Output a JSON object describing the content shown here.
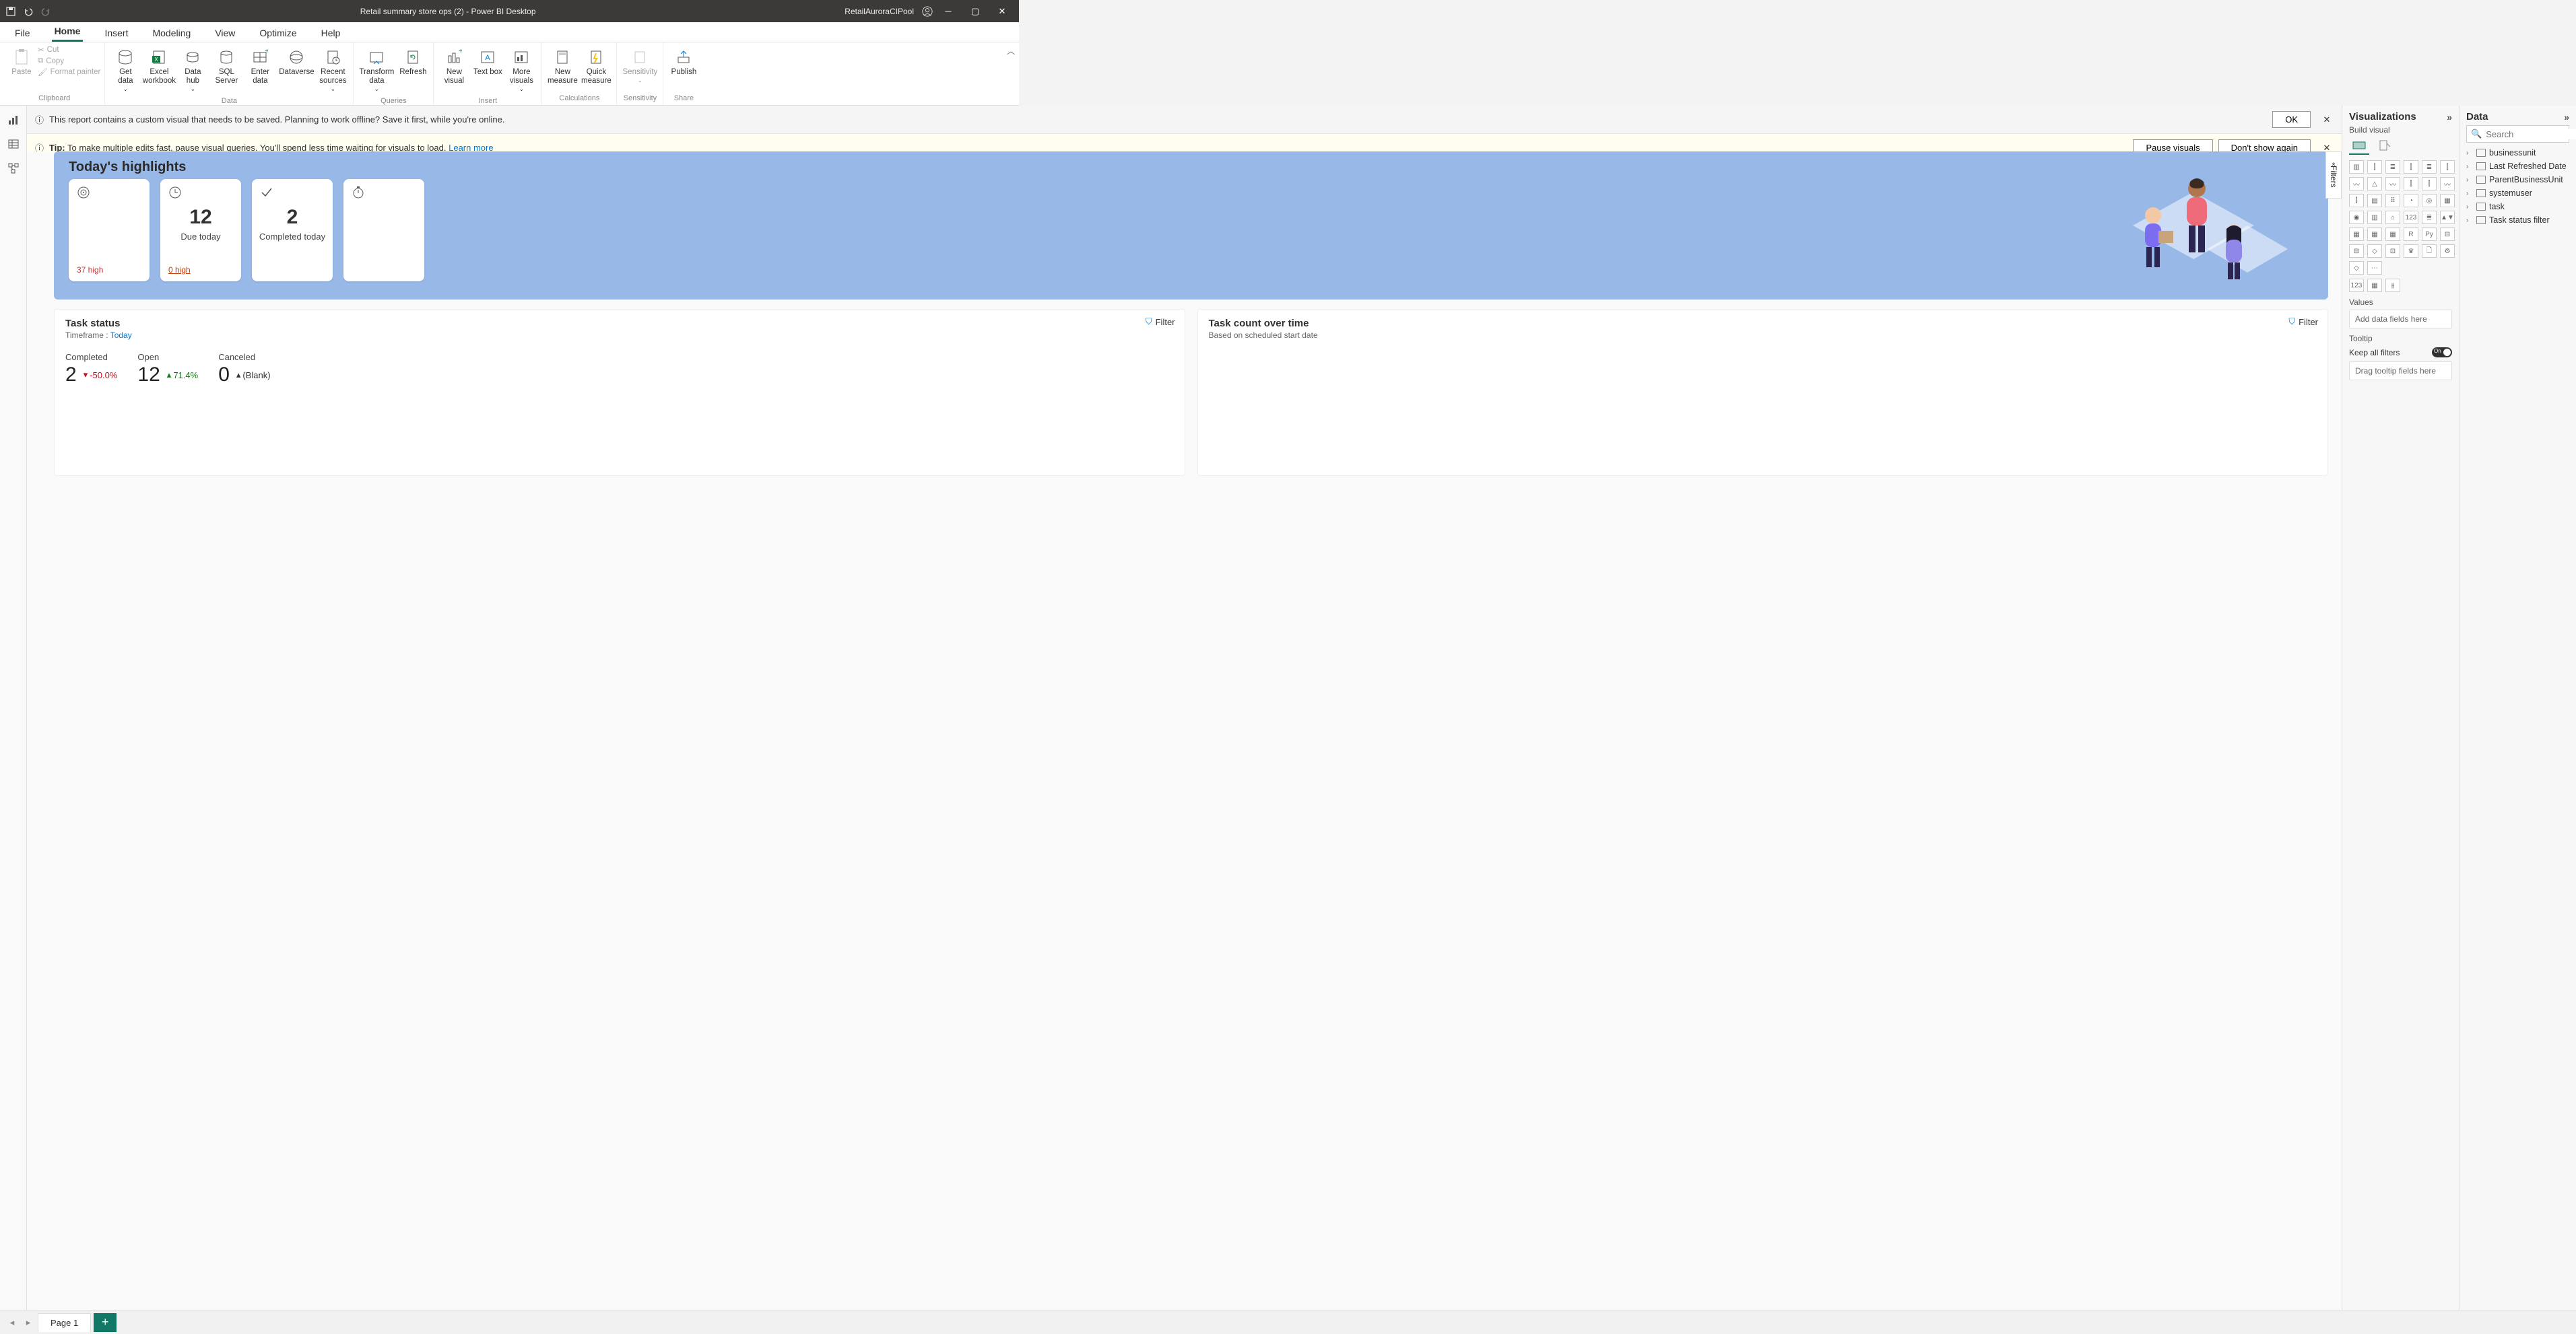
{
  "titlebar": {
    "title": "Retail summary store ops (2) - Power BI Desktop",
    "user": "RetailAuroraCIPool"
  },
  "menu": {
    "tabs": [
      "File",
      "Home",
      "Insert",
      "Modeling",
      "View",
      "Optimize",
      "Help"
    ],
    "active_index": 1
  },
  "ribbon": {
    "paste": "Paste",
    "clipboard": {
      "cut": "Cut",
      "copy": "Copy",
      "format_painter": "Format painter",
      "label": "Clipboard"
    },
    "data": {
      "get_data": "Get data",
      "excel": "Excel workbook",
      "hub": "Data hub",
      "sql": "SQL Server",
      "enter_data": "Enter data",
      "dataverse": "Dataverse",
      "recent": "Recent sources",
      "label": "Data"
    },
    "queries": {
      "transform": "Transform data",
      "refresh": "Refresh",
      "label": "Queries"
    },
    "insert": {
      "new_visual": "New visual",
      "text_box": "Text box",
      "more": "More visuals",
      "label": "Insert"
    },
    "calc": {
      "new_measure": "New measure",
      "quick_measure": "Quick measure",
      "label": "Calculations"
    },
    "sensitivity": {
      "btn": "Sensitivity",
      "label": "Sensitivity"
    },
    "share": {
      "publish": "Publish",
      "label": "Share"
    }
  },
  "banners": {
    "b1": {
      "text": "This report contains a custom visual that needs to be saved. Planning to work offline? Save it first, while you're online.",
      "ok": "OK"
    },
    "b2": {
      "tip": "Tip:",
      "text": " To make multiple edits fast, pause visual queries. You'll spend less time waiting for visuals to load.  ",
      "learn": "Learn more",
      "pause": "Pause visuals",
      "dont": "Don't show again"
    }
  },
  "hero": {
    "title": "Today's highlights",
    "cards": [
      {
        "icon": "target",
        "value": "",
        "label": "",
        "footnote": "37 high"
      },
      {
        "icon": "clock",
        "value": "12",
        "label": "Due today",
        "footnote": "0 high"
      },
      {
        "icon": "check",
        "value": "2",
        "label": "Completed today",
        "footnote": ""
      },
      {
        "icon": "stopwatch",
        "value": "",
        "label": "",
        "footnote": ""
      }
    ]
  },
  "panels": {
    "task_status": {
      "title": "Task status",
      "timeframe_label": "Timeframe : ",
      "timeframe_value": "Today",
      "filter": "Filter",
      "kpis": [
        {
          "label": "Completed",
          "value": "2",
          "delta": "-50.0%",
          "dir": "down"
        },
        {
          "label": "Open",
          "value": "12",
          "delta": "71.4%",
          "dir": "up"
        },
        {
          "label": "Canceled",
          "value": "0",
          "delta": "(Blank)",
          "dir": "blank"
        }
      ]
    },
    "task_count": {
      "title": "Task count over time",
      "sub": "Based on scheduled start date",
      "filter": "Filter"
    }
  },
  "filters_tab": "Filters",
  "viz_pane": {
    "title": "Visualizations",
    "build": "Build visual",
    "values": "Values",
    "values_placeholder": "Add data fields here",
    "tooltip": "Tooltip",
    "keep_filters": "Keep all filters",
    "keep_filters_state": "On",
    "tooltip_placeholder": "Drag tooltip fields here",
    "icons": [
      "▥",
      "⫿",
      "≣",
      "⫿",
      "≣",
      "⫿",
      "〰",
      "△",
      "〰",
      "⫿",
      "⫿",
      "〰",
      "⫿",
      "▤",
      "⠿",
      "◔",
      "◎",
      "▦",
      "◉",
      "▥",
      "⌂",
      "123",
      "≣",
      "▲▼",
      "▦",
      "▦",
      "▦",
      "R",
      "Py",
      "⊟",
      "⊟",
      "◇",
      "⊡",
      "♛",
      "🗋",
      "⚙",
      "◇",
      "⋯"
    ],
    "extra_icons": [
      "123",
      "▦",
      "⫵"
    ]
  },
  "data_pane": {
    "title": "Data",
    "search_placeholder": "Search",
    "fields": [
      "businessunit",
      "Last Refreshed Date",
      "ParentBusinessUnit",
      "systemuser",
      "task",
      "Task status filter"
    ]
  },
  "pagebar": {
    "page": "Page 1"
  }
}
